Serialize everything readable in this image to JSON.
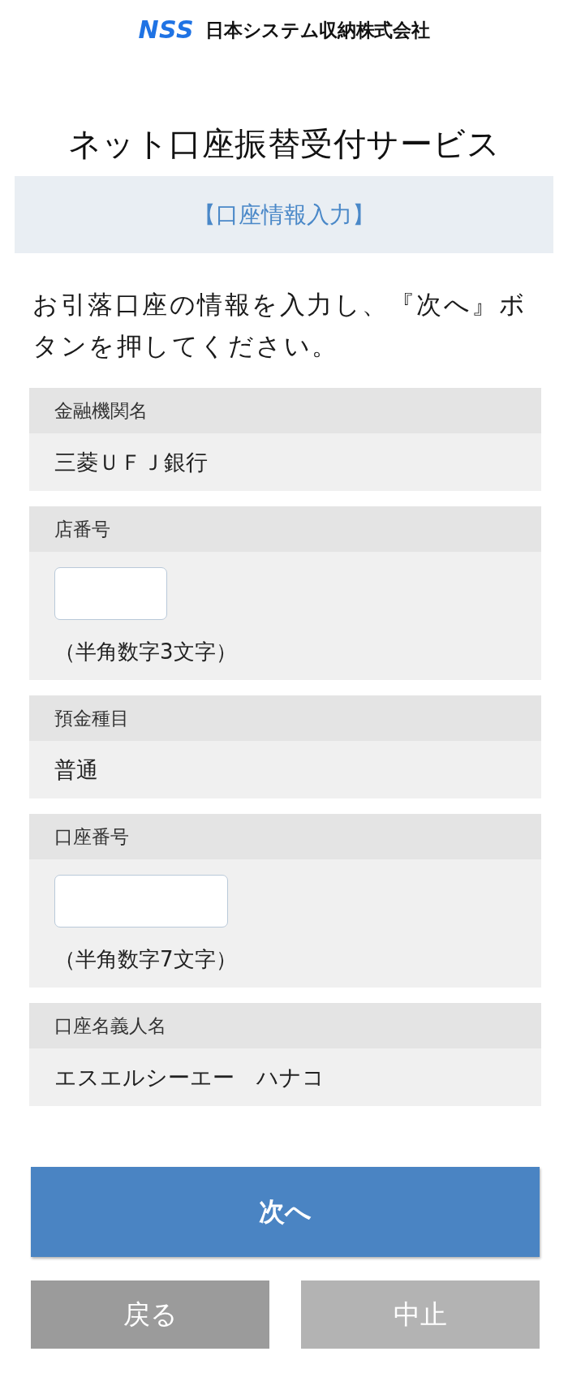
{
  "logo": {
    "mark": "NSS",
    "company": "日本システム収納株式会社"
  },
  "title": "ネット口座振替受付サービス",
  "step": "【口座情報入力】",
  "instruction": "お引落口座の情報を入力し、『次へ』ボタンを押してください。",
  "fields": [
    {
      "kind": "static",
      "label": "金融機関名",
      "value": "三菱ＵＦＪ銀行"
    },
    {
      "kind": "shortinput",
      "label": "店番号",
      "hint": "（半角数字3文字）"
    },
    {
      "kind": "static",
      "label": "預金種目",
      "value": "普通"
    },
    {
      "kind": "longinput",
      "label": "口座番号",
      "hint": "（半角数字7文字）"
    },
    {
      "kind": "static",
      "label": "口座名義人名",
      "value": "エスエルシーエー　ハナコ"
    }
  ],
  "buttons": [
    {
      "kind": "primary",
      "label": "次へ"
    },
    {
      "kind": "back",
      "label": "戻る"
    },
    {
      "kind": "cancel",
      "label": "中止"
    }
  ]
}
